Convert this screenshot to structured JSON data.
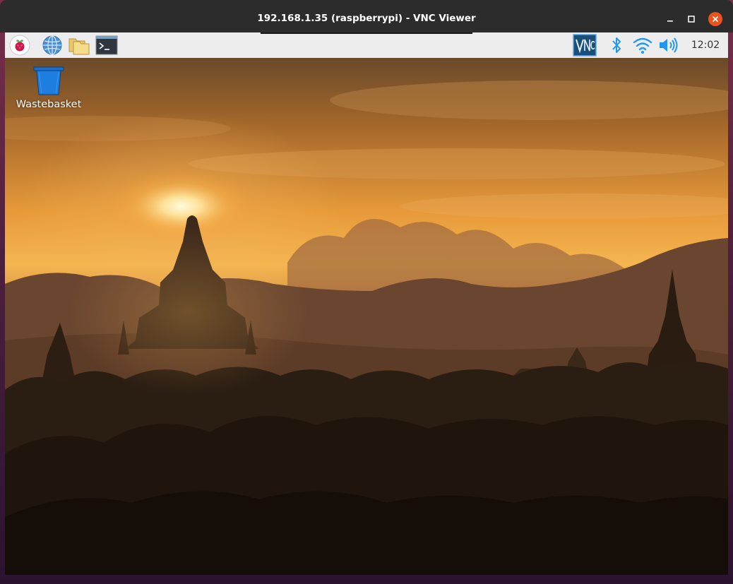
{
  "window": {
    "title": "192.168.1.35 (raspberrypi) - VNC Viewer",
    "controls": [
      "minimize-icon",
      "maximize-icon",
      "close-icon"
    ],
    "close_color": "#e95420"
  },
  "taskbar": {
    "launchers": [
      "raspberry-pi-menu-icon",
      "web-browser-icon",
      "file-manager-icon",
      "terminal-icon"
    ],
    "tray": [
      "vnc-server-icon",
      "bluetooth-icon",
      "wifi-icon",
      "volume-icon"
    ],
    "clock": "12:02"
  },
  "desktop": {
    "icons": [
      {
        "icon": "wastebasket-icon",
        "label": "Wastebasket"
      }
    ],
    "wallpaper": "sunset over temples"
  }
}
